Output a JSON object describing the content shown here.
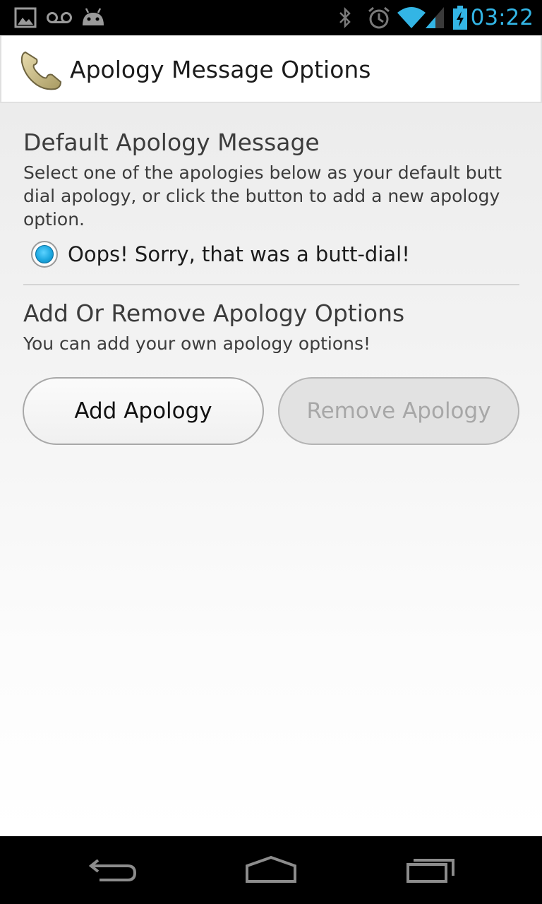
{
  "status_bar": {
    "time": "03:22",
    "time_color": "#33b5e5",
    "icons": [
      "gallery-icon",
      "voicemail-icon",
      "android-icon",
      "bluetooth-icon",
      "alarm-icon",
      "wifi-icon",
      "signal-icon",
      "battery-charging-icon"
    ]
  },
  "action_bar": {
    "title": "Apology Message Options",
    "icon": "phone-handset-icon"
  },
  "default_section": {
    "title": "Default Apology Message",
    "description": "Select one of the apologies below as your default butt dial apology, or click the button to add a new apology option.",
    "options": [
      {
        "label": "Oops! Sorry, that was a butt-dial!",
        "selected": true
      }
    ]
  },
  "manage_section": {
    "title": "Add Or Remove Apology Options",
    "description": "You can add your own apology options!",
    "add_label": "Add Apology",
    "remove_label": "Remove Apology",
    "remove_enabled": false
  },
  "nav_bar": {
    "icons": [
      "back-icon",
      "home-icon",
      "recent-apps-icon"
    ]
  },
  "colors": {
    "accent": "#33b5e5",
    "radio_selected": "#1da8e0"
  }
}
